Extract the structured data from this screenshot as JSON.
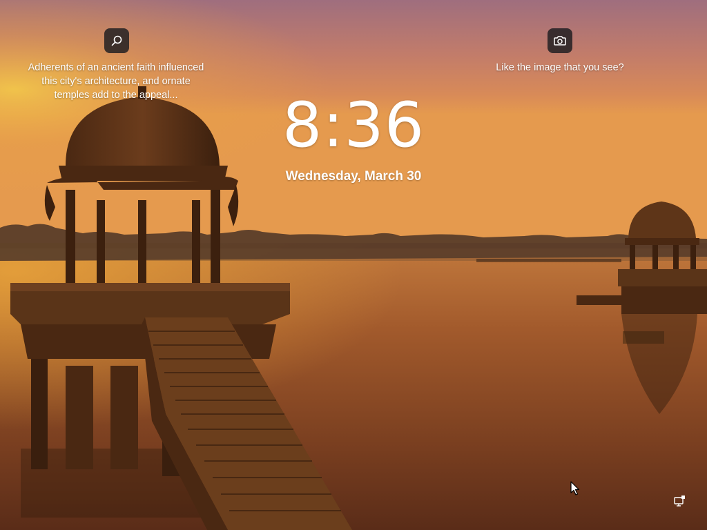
{
  "spotlight": {
    "info_icon": "search-icon",
    "info_text": "Adherents of an ancient faith influenced this city's architecture, and ornate temples add to the appeal...",
    "like_icon": "camera-icon",
    "like_text": "Like the image that you see?"
  },
  "clock": {
    "time": "8:36",
    "date": "Wednesday, March 30"
  },
  "status": {
    "network_icon": "network-icon"
  },
  "colors": {
    "sky_top": "#a9737d",
    "sky_mid": "#d9895a",
    "horizon": "#e8a04a",
    "water": "#8a4a22",
    "text": "#ffffff"
  }
}
